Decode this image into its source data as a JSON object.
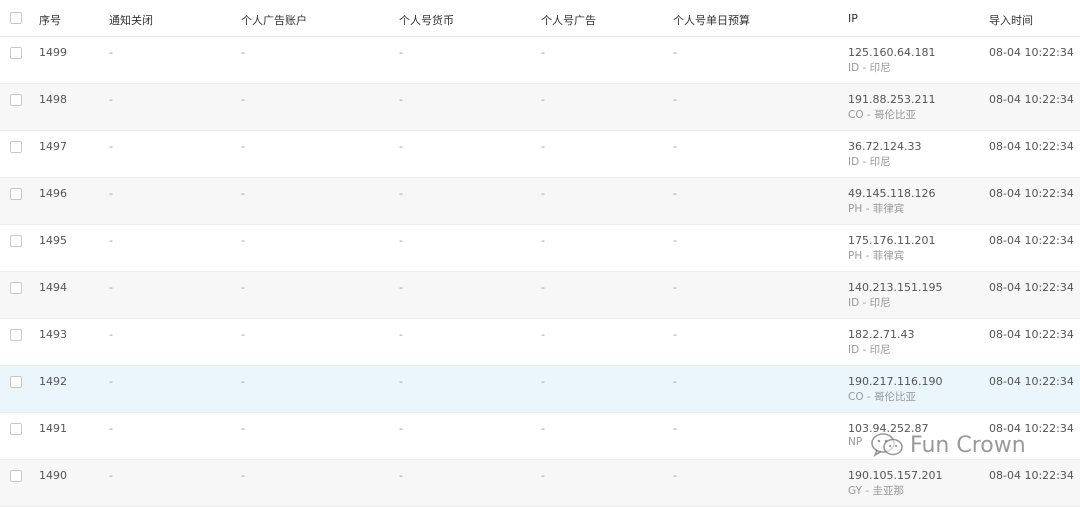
{
  "headers": [
    "序号",
    "通知关闭",
    "个人广告账户",
    "个人号货币",
    "个人号广告",
    "个人号单日预算",
    "IP",
    "导入时间"
  ],
  "rows": [
    {
      "id": "1499",
      "notify": "-",
      "ad_account": "-",
      "currency": "-",
      "ads": "-",
      "budget": "-",
      "ip": "125.160.64.181",
      "country": "ID - 印尼",
      "time": "08-04 10:22:34"
    },
    {
      "id": "1498",
      "notify": "-",
      "ad_account": "-",
      "currency": "-",
      "ads": "-",
      "budget": "-",
      "ip": "191.88.253.211",
      "country": "CO - 哥伦比亚",
      "time": "08-04 10:22:34"
    },
    {
      "id": "1497",
      "notify": "-",
      "ad_account": "-",
      "currency": "-",
      "ads": "-",
      "budget": "-",
      "ip": "36.72.124.33",
      "country": "ID - 印尼",
      "time": "08-04 10:22:34"
    },
    {
      "id": "1496",
      "notify": "-",
      "ad_account": "-",
      "currency": "-",
      "ads": "-",
      "budget": "-",
      "ip": "49.145.118.126",
      "country": "PH - 菲律宾",
      "time": "08-04 10:22:34"
    },
    {
      "id": "1495",
      "notify": "-",
      "ad_account": "-",
      "currency": "-",
      "ads": "-",
      "budget": "-",
      "ip": "175.176.11.201",
      "country": "PH - 菲律宾",
      "time": "08-04 10:22:34"
    },
    {
      "id": "1494",
      "notify": "-",
      "ad_account": "-",
      "currency": "-",
      "ads": "-",
      "budget": "-",
      "ip": "140.213.151.195",
      "country": "ID - 印尼",
      "time": "08-04 10:22:34"
    },
    {
      "id": "1493",
      "notify": "-",
      "ad_account": "-",
      "currency": "-",
      "ads": "-",
      "budget": "-",
      "ip": "182.2.71.43",
      "country": "ID - 印尼",
      "time": "08-04 10:22:34"
    },
    {
      "id": "1492",
      "notify": "-",
      "ad_account": "-",
      "currency": "-",
      "ads": "-",
      "budget": "-",
      "ip": "190.217.116.190",
      "country": "CO - 哥伦比亚",
      "time": "08-04 10:22:34"
    },
    {
      "id": "1491",
      "notify": "-",
      "ad_account": "-",
      "currency": "-",
      "ads": "-",
      "budget": "-",
      "ip": "103.94.252.87",
      "country": "NP",
      "time": "08-04 10:22:34"
    },
    {
      "id": "1490",
      "notify": "-",
      "ad_account": "-",
      "currency": "-",
      "ads": "-",
      "budget": "-",
      "ip": "190.105.157.201",
      "country": "GY - 圭亚那",
      "time": "08-04 10:22:34"
    }
  ],
  "watermark": {
    "text": "Fun Crown",
    "icon": "wechat-icon"
  }
}
